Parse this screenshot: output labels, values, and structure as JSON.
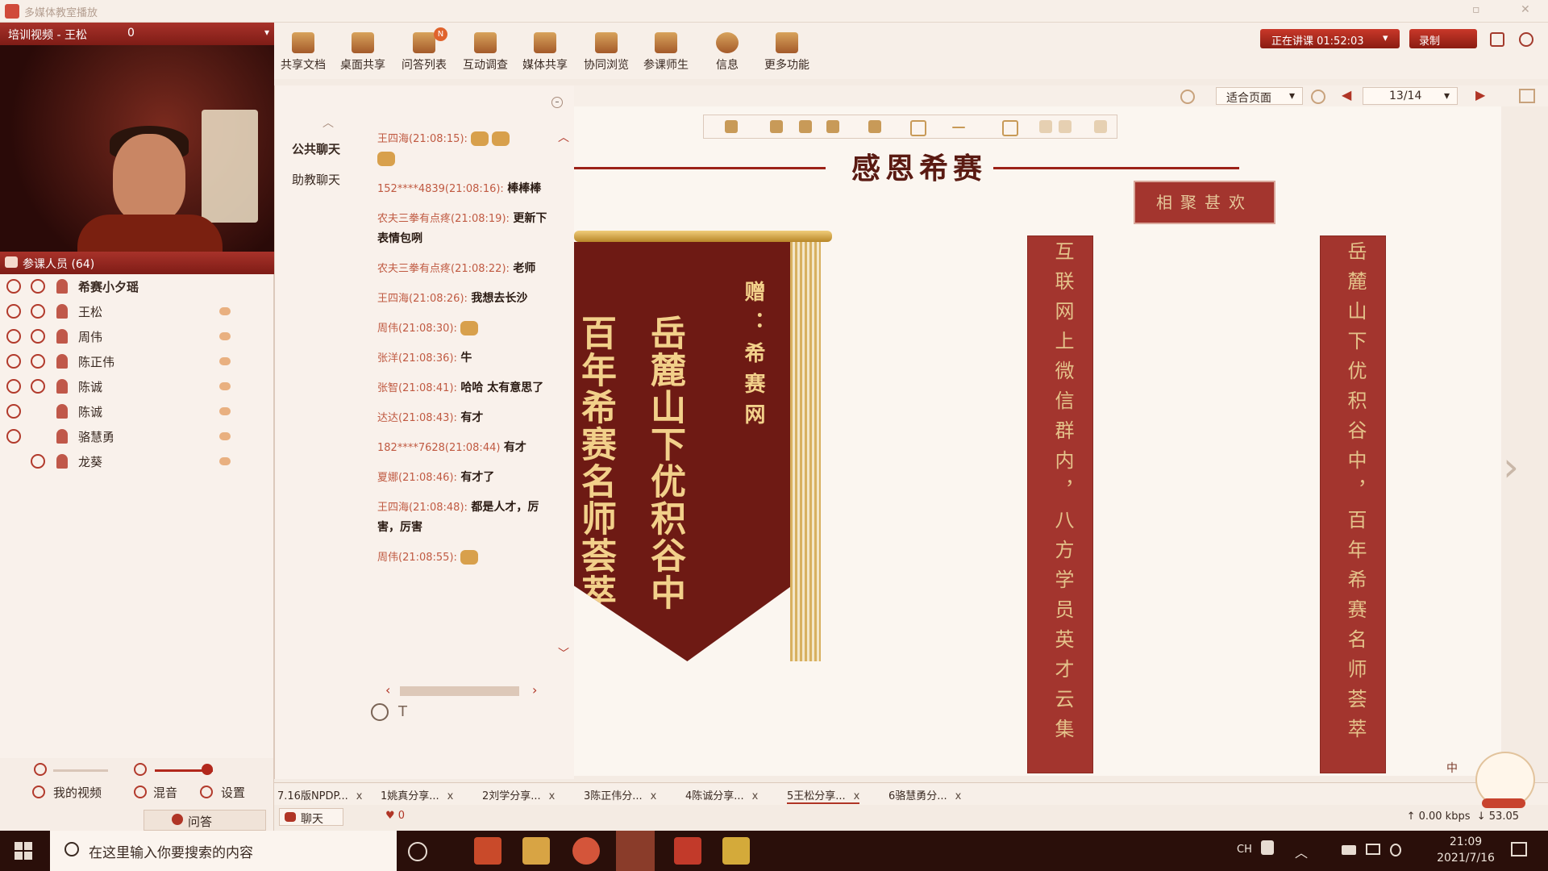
{
  "window": {
    "title": "多媒体教室播放"
  },
  "video_panel": {
    "title": "培训视频 - 王松",
    "viewer_count": "0"
  },
  "participants": {
    "title": "参课人员 (64)",
    "list": [
      {
        "name": "希赛小夕瑶"
      },
      {
        "name": "王松"
      },
      {
        "name": "周伟"
      },
      {
        "name": "陈正伟"
      },
      {
        "name": "陈诚"
      },
      {
        "name": "陈诚"
      },
      {
        "name": "骆慧勇"
      },
      {
        "name": "龙葵"
      }
    ]
  },
  "left_bottom": {
    "my_video": "我的视频",
    "mix": "混音",
    "settings": "设置",
    "qa_tab": "问答"
  },
  "toolbar": {
    "items": [
      {
        "label": "共享文档",
        "icon": "document-icon"
      },
      {
        "label": "桌面共享",
        "icon": "desktop-share-icon"
      },
      {
        "label": "问答列表",
        "icon": "qa-list-icon",
        "badge": "N"
      },
      {
        "label": "互动调查",
        "icon": "survey-icon"
      },
      {
        "label": "媒体共享",
        "icon": "media-share-icon"
      },
      {
        "label": "协同浏览",
        "icon": "browse-icon"
      },
      {
        "label": "参课师生",
        "icon": "users-icon"
      },
      {
        "label": "信息",
        "icon": "info-icon"
      },
      {
        "label": "更多功能",
        "icon": "more-icon"
      }
    ],
    "lecture_status": "正在讲课 01:52:03",
    "record": "录制"
  },
  "chat": {
    "tabs": [
      "公共聊天",
      "助教聊天"
    ],
    "messages": [
      {
        "sender": "王四海(21:08:15):",
        "text": ""
      },
      {
        "sender": "152****4839(21:08:16):",
        "text": "棒棒棒"
      },
      {
        "sender": "农夫三拳有点疼(21:08:19):",
        "text": "更新下表情包咧"
      },
      {
        "sender": "农夫三拳有点疼(21:08:22):",
        "text": "老师"
      },
      {
        "sender": "王四海(21:08:26):",
        "text": "我想去长沙"
      },
      {
        "sender": "周伟(21:08:30):",
        "text": ""
      },
      {
        "sender": "张洋(21:08:36):",
        "text": "牛"
      },
      {
        "sender": "张智(21:08:41):",
        "text": "哈哈 太有意思了"
      },
      {
        "sender": "达达(21:08:43):",
        "text": "有才"
      },
      {
        "sender": "182****7628(21:08:44)",
        "text": "有才"
      },
      {
        "sender": "夏娜(21:08:46):",
        "text": "有才了"
      },
      {
        "sender": "王四海(21:08:48):",
        "text": "都是人才，厉害，厉害"
      },
      {
        "sender": "周伟(21:08:55):",
        "text": ""
      }
    ]
  },
  "viewer": {
    "fit_mode": "适合页面",
    "page": "13/14"
  },
  "slide": {
    "title": "感恩希赛",
    "plaque": "相聚甚欢",
    "banner_right": "岳麓山下优积谷中",
    "banner_left": "百年希赛名师荟萃",
    "banner_gift": "赠：希赛网",
    "couplet_left": "互联网上微信群内，八方学员英才云集",
    "couplet_right": "岳麓山下优积谷中，百年希赛名师荟萃"
  },
  "doc_tabs": [
    {
      "label": "7.16版NPDP..."
    },
    {
      "label": "1姚真分享..."
    },
    {
      "label": "2刘学分享..."
    },
    {
      "label": "3陈正伟分..."
    },
    {
      "label": "4陈诚分享..."
    },
    {
      "label": "5王松分享...",
      "active": true
    },
    {
      "label": "6骆慧勇分..."
    }
  ],
  "status": {
    "chat_tab": "聊天",
    "likes": "0",
    "upload": "0.00 kbps",
    "download": "53.05"
  },
  "ime": "中",
  "taskbar": {
    "search_placeholder": "在这里输入你要搜索的内容",
    "lang": "CH",
    "time": "21:09",
    "date": "2021/7/16"
  }
}
